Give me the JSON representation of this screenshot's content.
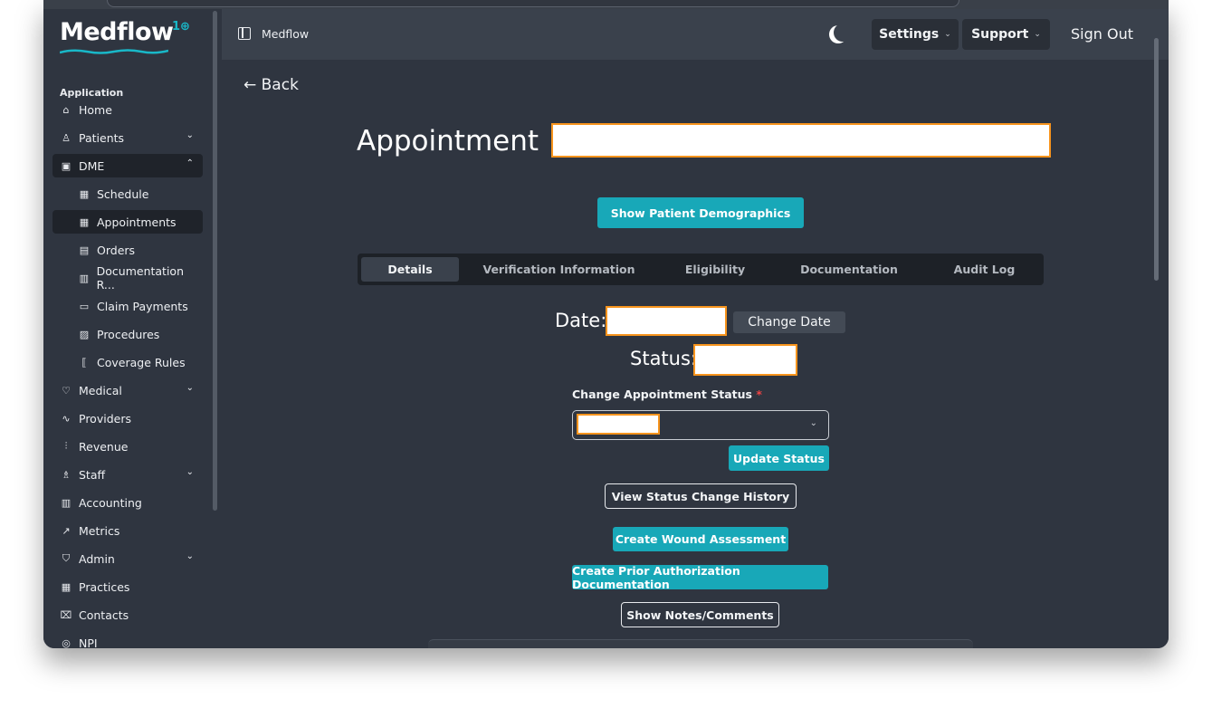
{
  "brand": {
    "name": "Medflow",
    "superscript": "1⊕",
    "wave_color": "#19b8c8"
  },
  "sidebar": {
    "section_label": "Application",
    "items": [
      {
        "label": "Home",
        "icon": "home-icon",
        "glyph": "⌂",
        "level": "top",
        "chevron": ""
      },
      {
        "label": "Patients",
        "icon": "user-icon",
        "glyph": "♙",
        "level": "top",
        "chevron": "⌄"
      },
      {
        "label": "DME",
        "icon": "briefcase-icon",
        "glyph": "▣",
        "level": "top",
        "chevron": "⌃",
        "active": true
      },
      {
        "label": "Schedule",
        "icon": "calendar-icon",
        "glyph": "▦",
        "level": "sub",
        "chevron": ""
      },
      {
        "label": "Appointments",
        "icon": "calendar-icon",
        "glyph": "▦",
        "level": "sub",
        "chevron": "",
        "active": true
      },
      {
        "label": "Orders",
        "icon": "package-icon",
        "glyph": "▤",
        "level": "sub",
        "chevron": ""
      },
      {
        "label": "Documentation R...",
        "icon": "document-icon",
        "glyph": "▥",
        "level": "sub",
        "chevron": ""
      },
      {
        "label": "Claim Payments",
        "icon": "payment-icon",
        "glyph": "▭",
        "level": "sub",
        "chevron": ""
      },
      {
        "label": "Procedures",
        "icon": "printer-icon",
        "glyph": "▨",
        "level": "sub",
        "chevron": ""
      },
      {
        "label": "Coverage Rules",
        "icon": "brackets-icon",
        "glyph": "⟦",
        "level": "sub",
        "chevron": ""
      },
      {
        "label": "Medical",
        "icon": "heart-pulse-icon",
        "glyph": "♡",
        "level": "top",
        "chevron": "⌄"
      },
      {
        "label": "Providers",
        "icon": "stethoscope-icon",
        "glyph": "∿",
        "level": "top",
        "chevron": ""
      },
      {
        "label": "Revenue",
        "icon": "bar-chart-icon",
        "glyph": "⫶",
        "level": "top",
        "chevron": ""
      },
      {
        "label": "Staff",
        "icon": "users-icon",
        "glyph": "♗",
        "level": "top",
        "chevron": "⌄"
      },
      {
        "label": "Accounting",
        "icon": "file-icon",
        "glyph": "▥",
        "level": "top",
        "chevron": ""
      },
      {
        "label": "Metrics",
        "icon": "trending-up-icon",
        "glyph": "↗",
        "level": "top",
        "chevron": ""
      },
      {
        "label": "Admin",
        "icon": "shield-icon",
        "glyph": "⛉",
        "level": "top",
        "chevron": "⌄"
      },
      {
        "label": "Practices",
        "icon": "building-icon",
        "glyph": "▦",
        "level": "top",
        "chevron": ""
      },
      {
        "label": "Contacts",
        "icon": "book-open-icon",
        "glyph": "⌧",
        "level": "top",
        "chevron": ""
      },
      {
        "label": "NPI",
        "icon": "fingerprint-icon",
        "glyph": "◎",
        "level": "top",
        "chevron": ""
      }
    ]
  },
  "topbar": {
    "title": "Medflow",
    "settings_label": "Settings",
    "support_label": "Support",
    "signout_label": "Sign Out",
    "chevron": "⌄"
  },
  "page": {
    "back_label": "← Back",
    "title": "Appointment",
    "show_demographics_label": "Show Patient Demographics",
    "tabs": [
      "Details",
      "Verification Information",
      "Eligibility",
      "Documentation",
      "Audit Log"
    ],
    "active_tab": "Details",
    "date_label": "Date:",
    "change_date_label": "Change Date",
    "status_label": "Status:",
    "change_status_label": "Change Appointment Status",
    "required_marker": "*",
    "update_status_label": "Update Status",
    "view_history_label": "View Status Change History",
    "create_wound_label": "Create Wound Assessment",
    "create_prior_auth_label": "Create Prior Authorization Documentation",
    "show_notes_label": "Show Notes/Comments"
  },
  "colors": {
    "accent": "#18a8b8",
    "redaction_border": "#f7941d",
    "background": "#2f3540",
    "topbar": "#3a414c"
  }
}
